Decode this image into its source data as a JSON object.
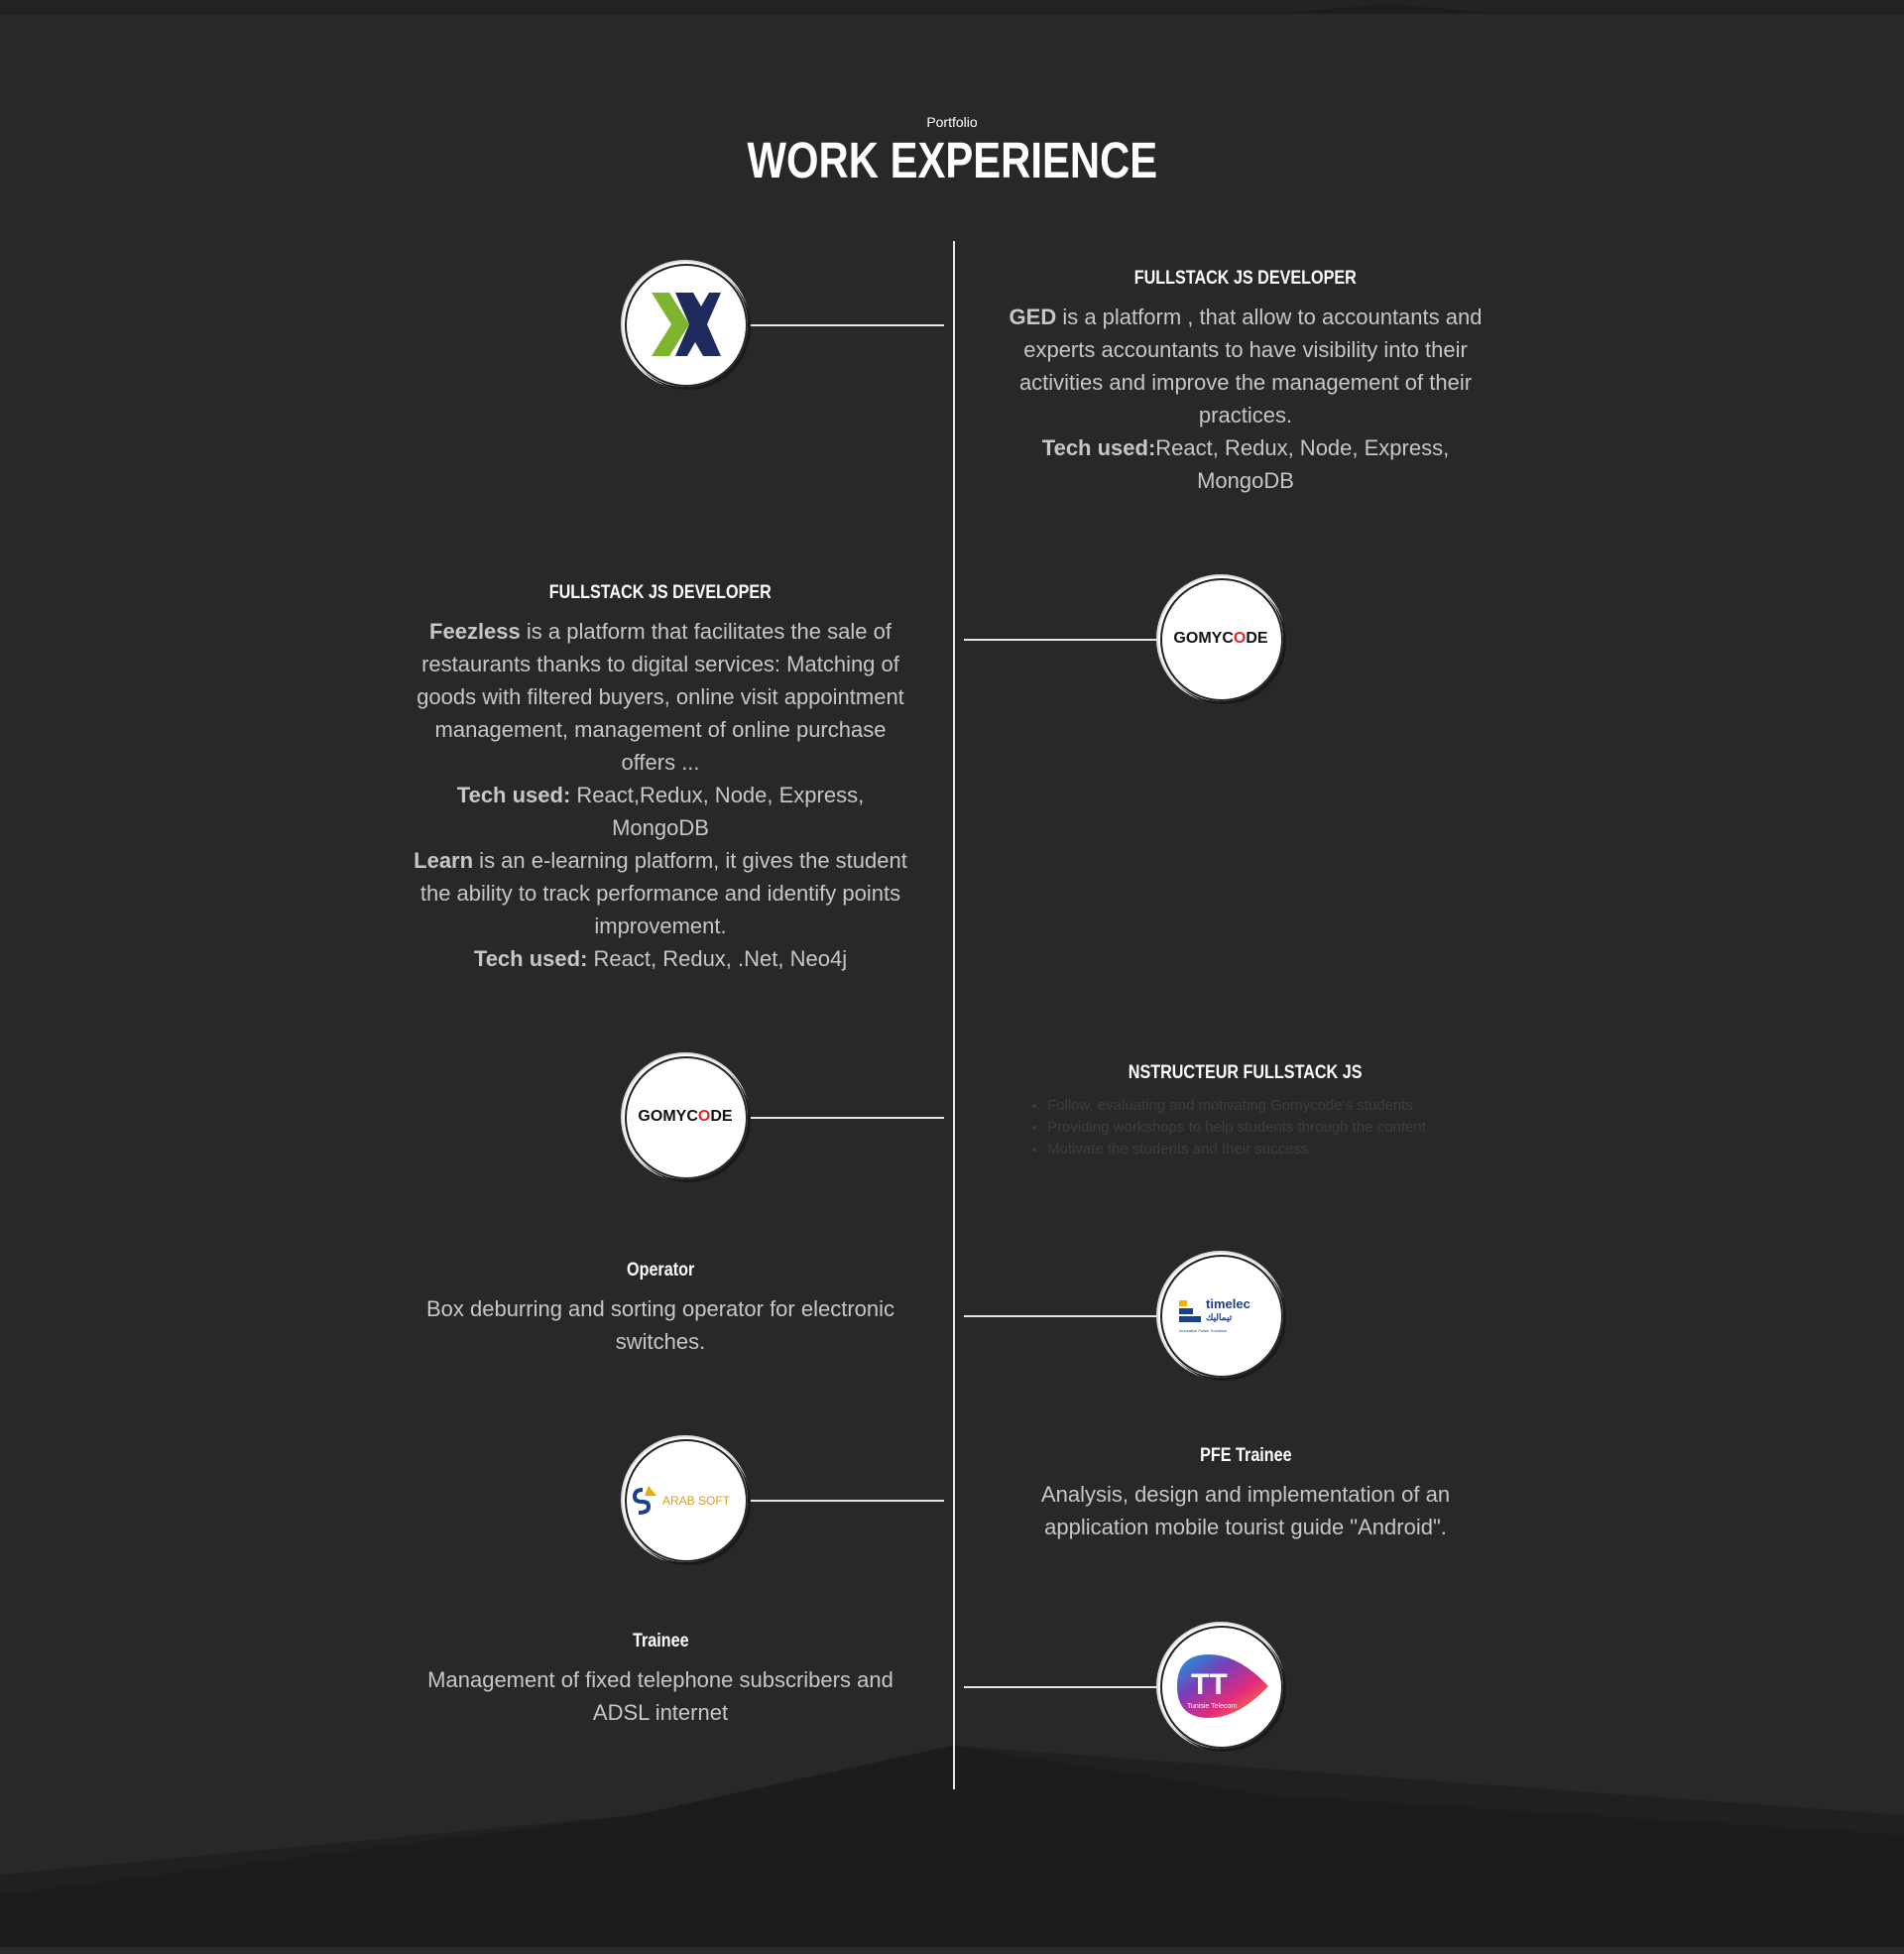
{
  "header": {
    "subtitle": "Portfolio",
    "title": "WORK EXPERIENCE"
  },
  "colors": {
    "background": "#282828",
    "line": "#e6e6e6",
    "title": "#ffffff",
    "body_text": "#c7c7c7"
  },
  "timeline": [
    {
      "title": "FULLSTACK JS DEVELOPER",
      "logo": "x-company-logo",
      "lines": [
        {
          "strong": "GED",
          "text": " is a platform , that allow to accountants and experts accountants to have visibility into their activities and improve the management of their practices."
        },
        {
          "strong": "Tech used:",
          "text": "React, Redux, Node, Express, MongoDB"
        }
      ]
    },
    {
      "title": "FULLSTACK JS DEVELOPER",
      "logo": "gomycode-logo",
      "logo_text": "GOMYCODE",
      "lines": [
        {
          "strong": "Feezless",
          "text": " is a platform that facilitates the sale of restaurants thanks to digital services: Matching of goods with filtered buyers, online visit appointment management, management of online purchase offers ..."
        },
        {
          "strong": "Tech used:",
          "text": " React,Redux, Node, Express, MongoDB"
        },
        {
          "strong": "Learn",
          "text": " is an e-learning platform, it gives the student the ability to track performance and identify points improvement."
        },
        {
          "strong": "Tech used:",
          "text": " React, Redux, .Net, Neo4j"
        }
      ]
    },
    {
      "title": "NSTRUCTEUR FULLSTACK JS",
      "logo": "gomycode-logo",
      "logo_text": "GOMYCODE",
      "bullets": [
        "Follow, evaluating and motivating Gomycode's students",
        "Providing workshops to help students through the content",
        "Motivate the students and their success"
      ]
    },
    {
      "title": "Operator",
      "logo": "timelec-logo",
      "logo_text": "timelec",
      "logo_subtext": "Innovative Power Solutions",
      "lines": [
        {
          "strong": "",
          "text": "Box deburring and sorting operator for electronic switches."
        }
      ]
    },
    {
      "title": "PFE Trainee",
      "logo": "arabsoft-logo",
      "logo_text": "ARAB SOFT",
      "lines": [
        {
          "strong": "",
          "text": "Analysis, design and implementation of an application mobile tourist guide \"Android\"."
        }
      ]
    },
    {
      "title": "Trainee",
      "logo": "tunisie-telecom-logo",
      "logo_text": "TT",
      "logo_subtext": "Tunisie Telecom",
      "lines": [
        {
          "strong": "",
          "text": "Management of fixed telephone subscribers and ADSL internet"
        }
      ]
    }
  ]
}
